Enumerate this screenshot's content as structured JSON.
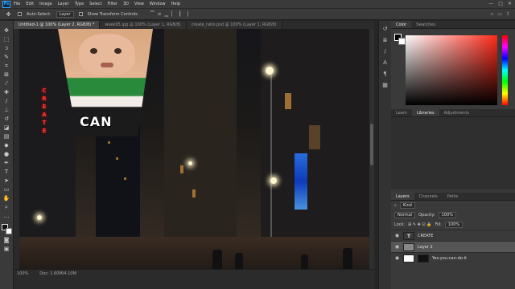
{
  "app": {
    "logo": "Ps"
  },
  "menu": [
    "File",
    "Edit",
    "Image",
    "Layer",
    "Type",
    "Select",
    "Filter",
    "3D",
    "View",
    "Window",
    "Help"
  ],
  "window_controls": [
    "—",
    "□",
    "✕"
  ],
  "options_bar": {
    "auto_select_label": "Auto-Select:",
    "auto_select_target": "Layer",
    "show_transform_label": "Show Transform Controls"
  },
  "doc_tabs": [
    {
      "label": "Untitled-1 @ 100% (Layer 2, RGB/8) *",
      "active": true
    },
    {
      "label": "week05.jpg @ 100% (Layer 1, RGB/8)",
      "active": false
    },
    {
      "label": "create_ratio.psd @ 100% (Layer 1, RGB/8)",
      "active": false
    }
  ],
  "canvas": {
    "sign_text": [
      "C",
      "R",
      "E",
      "A",
      "T",
      "E"
    ],
    "meme_caption": "CAN"
  },
  "status": {
    "zoom": "100%",
    "doc_size": "Doc: 1.60M/4.10M"
  },
  "color_panel": {
    "tabs": [
      "Color",
      "Swatches"
    ]
  },
  "library_panel": {
    "tabs": [
      "Learn",
      "Libraries",
      "Adjustments"
    ]
  },
  "layers_panel": {
    "tabs": [
      "Layers",
      "Channels",
      "Paths"
    ],
    "filter_label": "Kind",
    "blend_mode": "Normal",
    "opacity_label": "Opacity:",
    "opacity_value": "100%",
    "lock_label": "Lock:",
    "fill_label": "Fill:",
    "fill_value": "100%",
    "layers": [
      {
        "name": "CREATE",
        "type": "text",
        "selected": false
      },
      {
        "name": "Layer 2",
        "type": "image",
        "selected": true
      },
      {
        "name": "Yes-you-can-do-it",
        "type": "masked",
        "selected": false
      }
    ]
  },
  "colors": {
    "accent": "#31a8ff",
    "panel": "#3a3a3a",
    "sign": "#ff3b2f"
  }
}
